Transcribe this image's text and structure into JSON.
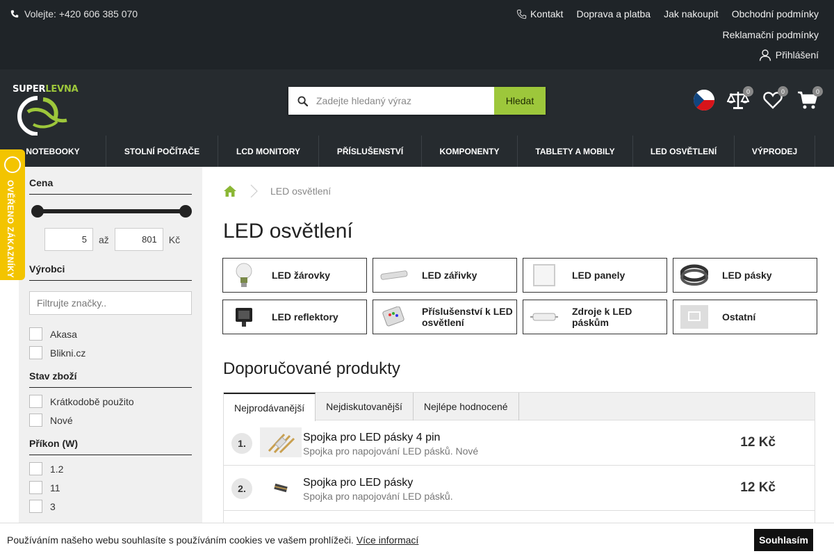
{
  "topbar": {
    "phone": "Volejte: +420 606 385 070",
    "links": [
      "Kontakt",
      "Doprava a platba",
      "Jak nakoupit",
      "Obchodní podmínky"
    ],
    "reklamace": "Reklamační podmínky",
    "login": "Přihlášení"
  },
  "logo": {
    "super": "SUPER",
    "levna": "LEVNA"
  },
  "search": {
    "placeholder": "Zadejte hledaný výraz",
    "button": "Hledat"
  },
  "header_icons": {
    "compare_count": "0",
    "wishlist_count": "0",
    "cart_count": "0"
  },
  "nav": [
    "NOTEBOOKY",
    "STOLNÍ POČÍTAČE",
    "LCD MONITORY",
    "PŘÍSLUŠENSTVÍ",
    "KOMPONENTY",
    "TABLETY A MOBILY",
    "LED OSVĚTLENÍ",
    "VÝPRODEJ"
  ],
  "verified": "Ověřeno zákazníky",
  "filters": {
    "price_title": "Cena",
    "price_min": "5",
    "price_to": "až",
    "price_max": "801",
    "currency": "Kč",
    "brands_title": "Výrobci",
    "brand_placeholder": "Filtrujte značky..",
    "brands": [
      "Akasa",
      "Blikni.cz"
    ],
    "condition_title": "Stav zboží",
    "conditions": [
      "Krátkodobě použito",
      "Nové"
    ],
    "power_title": "Příkon (W)",
    "powers": [
      "1.2",
      "11",
      "3"
    ]
  },
  "breadcrumb": {
    "current": "LED osvětlení"
  },
  "page_title": "LED osvětlení",
  "categories": [
    "LED žárovky",
    "LED zářivky",
    "LED panely",
    "LED pásky",
    "LED reflektory",
    "Příslušenství k LED osvětlení",
    "Zdroje k LED páskům",
    "Ostatní"
  ],
  "recommended_title": "Doporučované produkty",
  "tabs": [
    "Nejprodávanější",
    "Nejdiskutovanější",
    "Nejlépe hodnocené"
  ],
  "products": [
    {
      "num": "1.",
      "name": "Spojka pro LED pásky 4 pin",
      "desc": "Spojka pro napojování LED pásků. Nové",
      "price": "12 Kč"
    },
    {
      "num": "2.",
      "name": "Spojka pro LED pásky",
      "desc": "Spojka pro napojování LED pásků.",
      "price": "12 Kč"
    }
  ],
  "cookie": {
    "text": "Používáním našeho webu souhlasíte s používáním cookies ve vašem prohlížeči.",
    "link": "Více informací",
    "button": "Souhlasím"
  }
}
